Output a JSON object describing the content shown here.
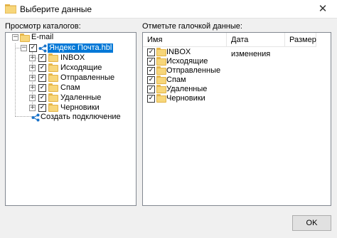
{
  "window": {
    "title": "Выберите данные",
    "close_glyph": "✕"
  },
  "tree_panel": {
    "label": "Просмотр каталогов:",
    "root": {
      "label": "E-mail",
      "icon": "email-folder-icon"
    },
    "account": {
      "label": "Яндекс Почта.hbl",
      "checked": true,
      "icon": "share-icon"
    },
    "folders": [
      {
        "label": "INBOX",
        "checked": true
      },
      {
        "label": "Исходящие",
        "checked": true
      },
      {
        "label": "Отправленные",
        "checked": true
      },
      {
        "label": "Спам",
        "checked": true
      },
      {
        "label": "Удаленные",
        "checked": true
      },
      {
        "label": "Черновики",
        "checked": true
      }
    ],
    "create_connection": {
      "label": "Создать подключение",
      "icon": "share-icon"
    }
  },
  "file_panel": {
    "label": "Отметьте галочкой данные:",
    "columns": {
      "name": "Имя",
      "modified": "Дата изменения",
      "size": "Размер"
    },
    "items": [
      {
        "label": "INBOX",
        "checked": true
      },
      {
        "label": "Исходящие",
        "checked": true
      },
      {
        "label": "Отправленные",
        "checked": true
      },
      {
        "label": "Спам",
        "checked": true
      },
      {
        "label": "Удаленные",
        "checked": true
      },
      {
        "label": "Черновики",
        "checked": true
      }
    ]
  },
  "buttons": {
    "ok": "OK"
  },
  "glyphs": {
    "expander_plus": "+",
    "expander_minus": "−",
    "check": "✓"
  },
  "colors": {
    "selection": "#0078d7",
    "folder": "#f7d67a",
    "share": "#1a73c9"
  }
}
